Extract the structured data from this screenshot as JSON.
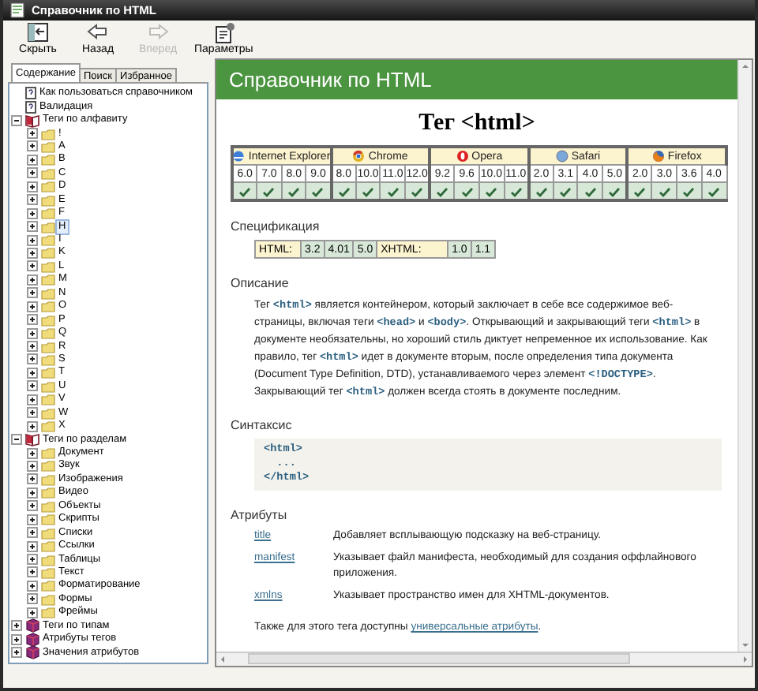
{
  "window": {
    "title": "Справочник по HTML"
  },
  "toolbar": {
    "buttons": [
      {
        "label": "Скрыть",
        "kind": "hide",
        "disabled": false
      },
      {
        "label": "Назад",
        "kind": "back",
        "disabled": false
      },
      {
        "label": "Вперед",
        "kind": "forward",
        "disabled": true
      },
      {
        "label": "Параметры",
        "kind": "options",
        "disabled": false
      }
    ]
  },
  "tabs": [
    {
      "label": "Содержание",
      "selected": true
    },
    {
      "label": "Поиск",
      "selected": false
    },
    {
      "label": "Избранное",
      "selected": false
    }
  ],
  "tree": [
    {
      "label": "Как пользоваться справочником",
      "kind": "page",
      "selected": false
    },
    {
      "label": "Валидация",
      "kind": "page",
      "selected": false
    },
    {
      "label": "Теги по алфавиту",
      "kind": "book",
      "expanded": true,
      "selected": false,
      "children": [
        {
          "label": "!",
          "kind": "folder",
          "expanded": false,
          "selected": false
        },
        {
          "label": "A",
          "kind": "folder",
          "expanded": false,
          "selected": false
        },
        {
          "label": "B",
          "kind": "folder",
          "expanded": false,
          "selected": false
        },
        {
          "label": "C",
          "kind": "folder",
          "expanded": false,
          "selected": false
        },
        {
          "label": "D",
          "kind": "folder",
          "expanded": false,
          "selected": false
        },
        {
          "label": "E",
          "kind": "folder",
          "expanded": false,
          "selected": false
        },
        {
          "label": "F",
          "kind": "folder",
          "expanded": false,
          "selected": false
        },
        {
          "label": "H",
          "kind": "folder",
          "expanded": false,
          "selected": true
        },
        {
          "label": "I",
          "kind": "folder",
          "expanded": false,
          "selected": false
        },
        {
          "label": "K",
          "kind": "folder",
          "expanded": false,
          "selected": false
        },
        {
          "label": "L",
          "kind": "folder",
          "expanded": false,
          "selected": false
        },
        {
          "label": "M",
          "kind": "folder",
          "expanded": false,
          "selected": false
        },
        {
          "label": "N",
          "kind": "folder",
          "expanded": false,
          "selected": false
        },
        {
          "label": "O",
          "kind": "folder",
          "expanded": false,
          "selected": false
        },
        {
          "label": "P",
          "kind": "folder",
          "expanded": false,
          "selected": false
        },
        {
          "label": "Q",
          "kind": "folder",
          "expanded": false,
          "selected": false
        },
        {
          "label": "R",
          "kind": "folder",
          "expanded": false,
          "selected": false
        },
        {
          "label": "S",
          "kind": "folder",
          "expanded": false,
          "selected": false
        },
        {
          "label": "T",
          "kind": "folder",
          "expanded": false,
          "selected": false
        },
        {
          "label": "U",
          "kind": "folder",
          "expanded": false,
          "selected": false
        },
        {
          "label": "V",
          "kind": "folder",
          "expanded": false,
          "selected": false
        },
        {
          "label": "W",
          "kind": "folder",
          "expanded": false,
          "selected": false
        },
        {
          "label": "X",
          "kind": "folder",
          "expanded": false,
          "selected": false
        }
      ]
    },
    {
      "label": "Теги по разделам",
      "kind": "book",
      "expanded": true,
      "selected": false,
      "children": [
        {
          "label": "Документ",
          "kind": "folder",
          "expanded": false,
          "selected": false
        },
        {
          "label": "Звук",
          "kind": "folder",
          "expanded": false,
          "selected": false
        },
        {
          "label": "Изображения",
          "kind": "folder",
          "expanded": false,
          "selected": false
        },
        {
          "label": "Видео",
          "kind": "folder",
          "expanded": false,
          "selected": false
        },
        {
          "label": "Объекты",
          "kind": "folder",
          "expanded": false,
          "selected": false
        },
        {
          "label": "Скрипты",
          "kind": "folder",
          "expanded": false,
          "selected": false
        },
        {
          "label": "Списки",
          "kind": "folder",
          "expanded": false,
          "selected": false
        },
        {
          "label": "Ссылки",
          "kind": "folder",
          "expanded": false,
          "selected": false
        },
        {
          "label": "Таблицы",
          "kind": "folder",
          "expanded": false,
          "selected": false
        },
        {
          "label": "Текст",
          "kind": "folder",
          "expanded": false,
          "selected": false
        },
        {
          "label": "Форматирование",
          "kind": "folder",
          "expanded": false,
          "selected": false
        },
        {
          "label": "Формы",
          "kind": "folder",
          "expanded": false,
          "selected": false
        },
        {
          "label": "Фреймы",
          "kind": "folder",
          "expanded": false,
          "selected": false
        }
      ]
    },
    {
      "label": "Теги по типам",
      "kind": "book",
      "expanded": false,
      "selected": false
    },
    {
      "label": "Атрибуты тегов",
      "kind": "book",
      "expanded": false,
      "selected": false
    },
    {
      "label": "Значения атрибутов",
      "kind": "book",
      "expanded": false,
      "selected": false
    }
  ],
  "page": {
    "header": "Справочник по HTML",
    "heading": "Тег <html>",
    "browsers": [
      {
        "name": "Internet Explorer",
        "kind": "ie",
        "versions": [
          {
            "version": "6.0",
            "supported": true
          },
          {
            "version": "7.0",
            "supported": true
          },
          {
            "version": "8.0",
            "supported": true
          },
          {
            "version": "9.0",
            "supported": true
          }
        ]
      },
      {
        "name": "Chrome",
        "kind": "chrome",
        "versions": [
          {
            "version": "8.0",
            "supported": true
          },
          {
            "version": "10.0",
            "supported": true
          },
          {
            "version": "11.0",
            "supported": true
          },
          {
            "version": "12.0",
            "supported": true
          }
        ]
      },
      {
        "name": "Opera",
        "kind": "opera",
        "versions": [
          {
            "version": "9.2",
            "supported": true
          },
          {
            "version": "9.6",
            "supported": true
          },
          {
            "version": "10.0",
            "supported": true
          },
          {
            "version": "11.0",
            "supported": true
          }
        ]
      },
      {
        "name": "Safari",
        "kind": "safari",
        "versions": [
          {
            "version": "2.0",
            "supported": true
          },
          {
            "version": "3.1",
            "supported": true
          },
          {
            "version": "4.0",
            "supported": true
          },
          {
            "version": "5.0",
            "supported": true
          }
        ]
      },
      {
        "name": "Firefox",
        "kind": "firefox",
        "versions": [
          {
            "version": "2.0",
            "supported": true
          },
          {
            "version": "3.0",
            "supported": true
          },
          {
            "version": "3.6",
            "supported": true
          },
          {
            "version": "4.0",
            "supported": true
          }
        ]
      }
    ],
    "spec": {
      "title": "Спецификация",
      "standards": [
        {
          "name": "HTML:",
          "versions": [
            "3.2",
            "4.01",
            "5.0"
          ]
        },
        {
          "name": "XHTML:",
          "versions": [
            "1.0",
            "1.1"
          ]
        }
      ]
    },
    "description": {
      "title": "Описание",
      "segments": [
        {
          "kind": "text",
          "text": "Тег "
        },
        {
          "kind": "code",
          "text": "<html>"
        },
        {
          "kind": "text",
          "text": " является контейнером, который заключает в себе все содержимое веб-страницы, включая теги "
        },
        {
          "kind": "code",
          "text": "<head>"
        },
        {
          "kind": "text",
          "text": " и "
        },
        {
          "kind": "code",
          "text": "<body>"
        },
        {
          "kind": "text",
          "text": ". Открывающий и закрывающий теги "
        },
        {
          "kind": "code",
          "text": "<html>"
        },
        {
          "kind": "text",
          "text": " в документе необязательны, но хороший стиль диктует непременное их использование. Как правило, тег "
        },
        {
          "kind": "code",
          "text": "<html>"
        },
        {
          "kind": "text",
          "text": " идет в документе вторым, после определения типа документа (Document Type Definition, DTD), устанавливаемого через элемент "
        },
        {
          "kind": "code",
          "text": "<!DOCTYPE>"
        },
        {
          "kind": "text",
          "text": ". Закрывающий тег "
        },
        {
          "kind": "code",
          "text": "<html>"
        },
        {
          "kind": "text",
          "text": " должен всегда стоять в документе последним."
        }
      ]
    },
    "syntax": {
      "title": "Синтаксис",
      "lines": [
        "<html>",
        "  ...",
        "</html>"
      ]
    },
    "attributes": {
      "title": "Атрибуты",
      "items": [
        {
          "name": "title",
          "description": "Добавляет всплывающую подсказку на веб-страницу."
        },
        {
          "name": "manifest",
          "description": "Указывает файл манифеста, необходимый для создания оффлайнового приложения."
        },
        {
          "name": "xmlns",
          "description": "Указывает пространство имен для XHTML-документов."
        }
      ]
    },
    "footer": {
      "text": "Также для этого тега доступны ",
      "link": "универсальные атрибуты",
      "end": "."
    }
  }
}
